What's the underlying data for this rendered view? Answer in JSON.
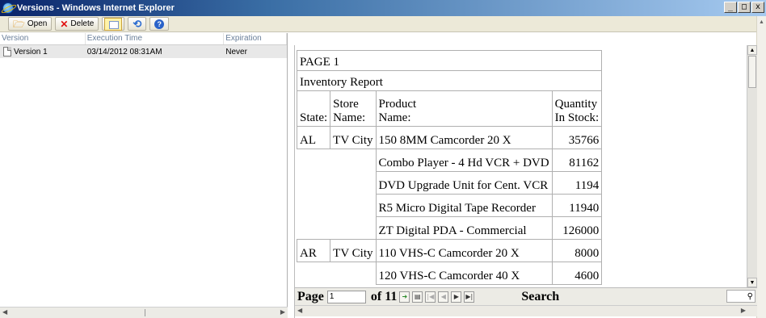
{
  "window": {
    "title": "Versions - Windows Internet Explorer",
    "minimize": "_",
    "maximize": "□",
    "close": "x"
  },
  "toolbar": {
    "open_label": "Open",
    "delete_label": "Delete"
  },
  "list": {
    "columns": [
      "Version",
      "Execution Time",
      "Expiration"
    ],
    "rows": [
      {
        "version": "Version 1",
        "execution_time": "03/14/2012 08:31AM",
        "expiration": "Never"
      }
    ]
  },
  "report": {
    "page_title": "PAGE 1",
    "report_title": "Inventory Report",
    "headers": {
      "state": "State:",
      "store_1": "Store",
      "store_2": "Name:",
      "product_1": "Product",
      "product_2": "Name:",
      "qty_1": "Quantity",
      "qty_2": "In Stock:"
    },
    "rows": [
      {
        "state": "AL",
        "store": "TV City",
        "product": "150 8MM Camcorder 20 X",
        "qty": "35766"
      },
      {
        "state": "",
        "store": "",
        "product": "Combo Player - 4 Hd VCR + DVD",
        "qty": "81162"
      },
      {
        "state": "",
        "store": "",
        "product": "DVD Upgrade Unit for Cent. VCR",
        "qty": "1194"
      },
      {
        "state": "",
        "store": "",
        "product": "R5 Micro Digital Tape Recorder",
        "qty": "11940"
      },
      {
        "state": "",
        "store": "",
        "product": "ZT Digital PDA - Commercial",
        "qty": "126000"
      },
      {
        "state": "AR",
        "store": "TV City",
        "product": "110 VHS-C Camcorder 20 X",
        "qty": "8000"
      },
      {
        "state": "",
        "store": "",
        "product": "120 VHS-C Camcorder 40 X",
        "qty": "4600"
      }
    ]
  },
  "navbar": {
    "page_label": "Page",
    "page_value": "1",
    "of_label": "of 11",
    "search_label": "Search"
  },
  "icons": {
    "open": "folder-open-icon",
    "delete": "delete-x-icon",
    "layout": "layout-icon",
    "refresh": "refresh-icon",
    "help": "help-icon"
  }
}
